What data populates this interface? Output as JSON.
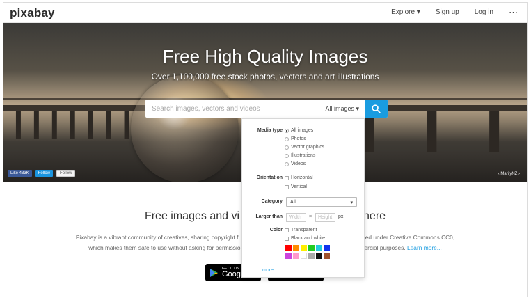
{
  "topbar": {
    "logo": "pixabay",
    "nav": {
      "explore": "Explore ▾",
      "signup": "Sign up",
      "login": "Log in",
      "more": "⋯"
    }
  },
  "hero": {
    "title": "Free High Quality Images",
    "subtitle": "Over 1,100,000 free stock photos, vectors and art illustrations",
    "search": {
      "placeholder": "Search images, vectors and videos",
      "type": "All images ▾",
      "icon": "search-icon"
    },
    "social": {
      "like": "Like 433K",
      "twitter": "Follow",
      "google": "Follow"
    },
    "credit": "‹ MarilyNZ ›"
  },
  "dropdown": {
    "media_type_label": "Media type",
    "media_types": [
      "All images",
      "Photos",
      "Vector graphics",
      "Illustrations",
      "Videos"
    ],
    "selected_media": "All images",
    "orientation_label": "Orientation",
    "orientations": [
      "Horizontal",
      "Vertical"
    ],
    "category_label": "Category",
    "category_value": "All",
    "larger_than_label": "Larger than",
    "width_placeholder": "Width",
    "height_placeholder": "Height",
    "times": "×",
    "px": "px",
    "color_label": "Color",
    "color_options": [
      "Transparent",
      "Black and white"
    ],
    "swatches": [
      "#ff0000",
      "#ff8c00",
      "#ffee00",
      "#22cc22",
      "#22ccdd",
      "#1133ee",
      "#cc44dd",
      "#ff99cc",
      "#ffffff",
      "#aaaaaa",
      "#111111",
      "#a0522d"
    ],
    "more": "more..."
  },
  "main": {
    "title_left": "Free images and vi",
    "title_right": "here",
    "text_line1_left": "Pixabay is a vibrant community of creatives, sharing copyright f",
    "text_line1_right": "sed under Creative Commons CC0,",
    "text_line2_left": "which makes them safe to use without asking for permissio",
    "text_line2_right": "ercial purposes.",
    "learn_more": "Learn more...",
    "google_play_small": "GET IT ON",
    "google_play_big": "Googl"
  }
}
